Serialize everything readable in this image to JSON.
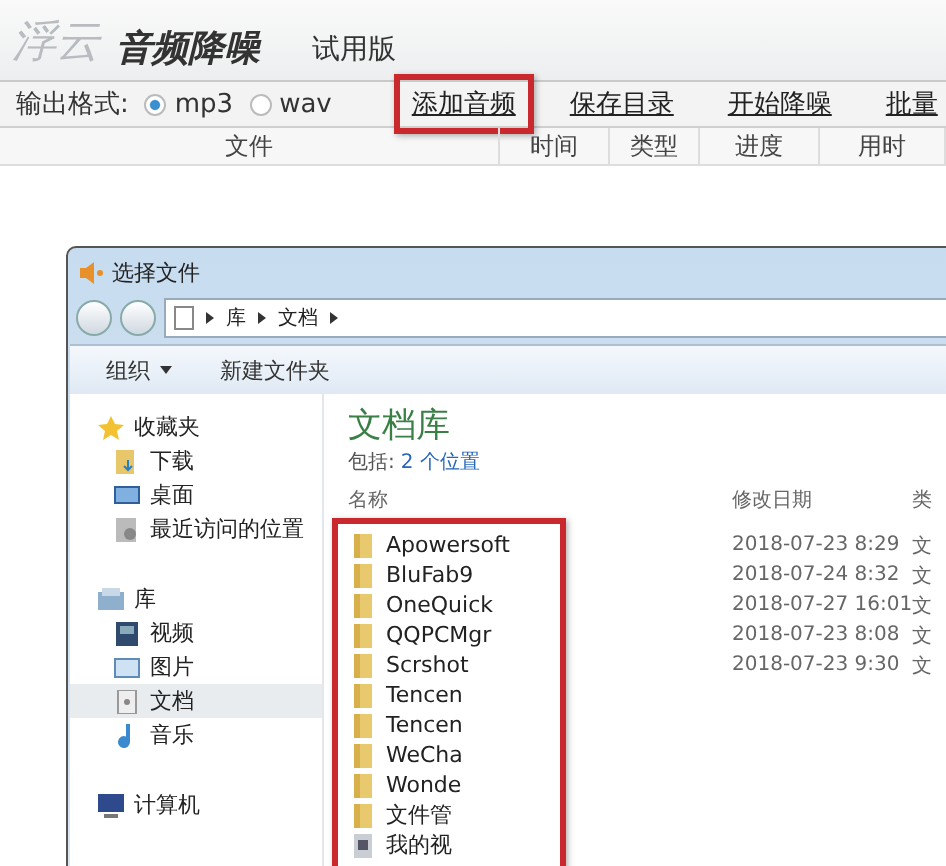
{
  "app": {
    "brand": "浮云",
    "title": "音频降噪",
    "edition": "试用版"
  },
  "toolbar": {
    "format_label": "输出格式:",
    "formats": [
      {
        "label": "mp3",
        "selected": true
      },
      {
        "label": "wav",
        "selected": false
      }
    ],
    "actions": [
      {
        "label": "添加音频",
        "highlighted": true
      },
      {
        "label": "保存目录",
        "highlighted": false
      },
      {
        "label": "开始降噪",
        "highlighted": false
      },
      {
        "label": "批量",
        "highlighted": false
      }
    ]
  },
  "columns": [
    "文件",
    "时间",
    "类型",
    "进度",
    "用时"
  ],
  "dialog": {
    "title": "选择文件",
    "breadcrumb": [
      "库",
      "文档"
    ],
    "commands": [
      {
        "label": "组织",
        "kind": "menu"
      },
      {
        "label": "新建文件夹",
        "kind": "button"
      }
    ],
    "sidebar": [
      {
        "label": "收藏夹",
        "kind": "star",
        "selected": false,
        "children": [
          {
            "label": "下载",
            "kind": "download",
            "selected": false
          },
          {
            "label": "桌面",
            "kind": "desktop",
            "selected": false
          },
          {
            "label": "最近访问的位置",
            "kind": "recent",
            "selected": false
          }
        ]
      },
      {
        "label": "库",
        "kind": "library",
        "selected": false,
        "children": [
          {
            "label": "视频",
            "kind": "video",
            "selected": false
          },
          {
            "label": "图片",
            "kind": "picture",
            "selected": false
          },
          {
            "label": "文档",
            "kind": "document",
            "selected": true
          },
          {
            "label": "音乐",
            "kind": "music",
            "selected": false
          }
        ]
      },
      {
        "label": "计算机",
        "kind": "computer",
        "selected": false
      }
    ],
    "library_title": "文档库",
    "includes_label": "包括:",
    "includes_link": "2 个位置",
    "columns": [
      "名称",
      "修改日期",
      "类"
    ],
    "list_highlighted": true,
    "files": [
      {
        "name": "Apowersoft",
        "kind": "folder",
        "date": "2018-07-23 8:29",
        "type": "文"
      },
      {
        "name": "BluFab9",
        "kind": "folder",
        "date": "2018-07-24 8:32",
        "type": "文"
      },
      {
        "name": "OneQuick",
        "kind": "folder",
        "date": "2018-07-27 16:01",
        "type": "文"
      },
      {
        "name": "QQPCMgr",
        "kind": "folder",
        "date": "2018-07-23 8:08",
        "type": "文"
      },
      {
        "name": "Scrshot",
        "kind": "folder",
        "date": "2018-07-23 9:30",
        "type": "文"
      },
      {
        "name": "Tencen",
        "kind": "folder"
      },
      {
        "name": "Tencen",
        "kind": "folder"
      },
      {
        "name": "WeCha",
        "kind": "folder"
      },
      {
        "name": "Wonde",
        "kind": "folder"
      },
      {
        "name": "文件管",
        "kind": "folder"
      },
      {
        "name": "我的视",
        "kind": "video-folder"
      }
    ]
  }
}
